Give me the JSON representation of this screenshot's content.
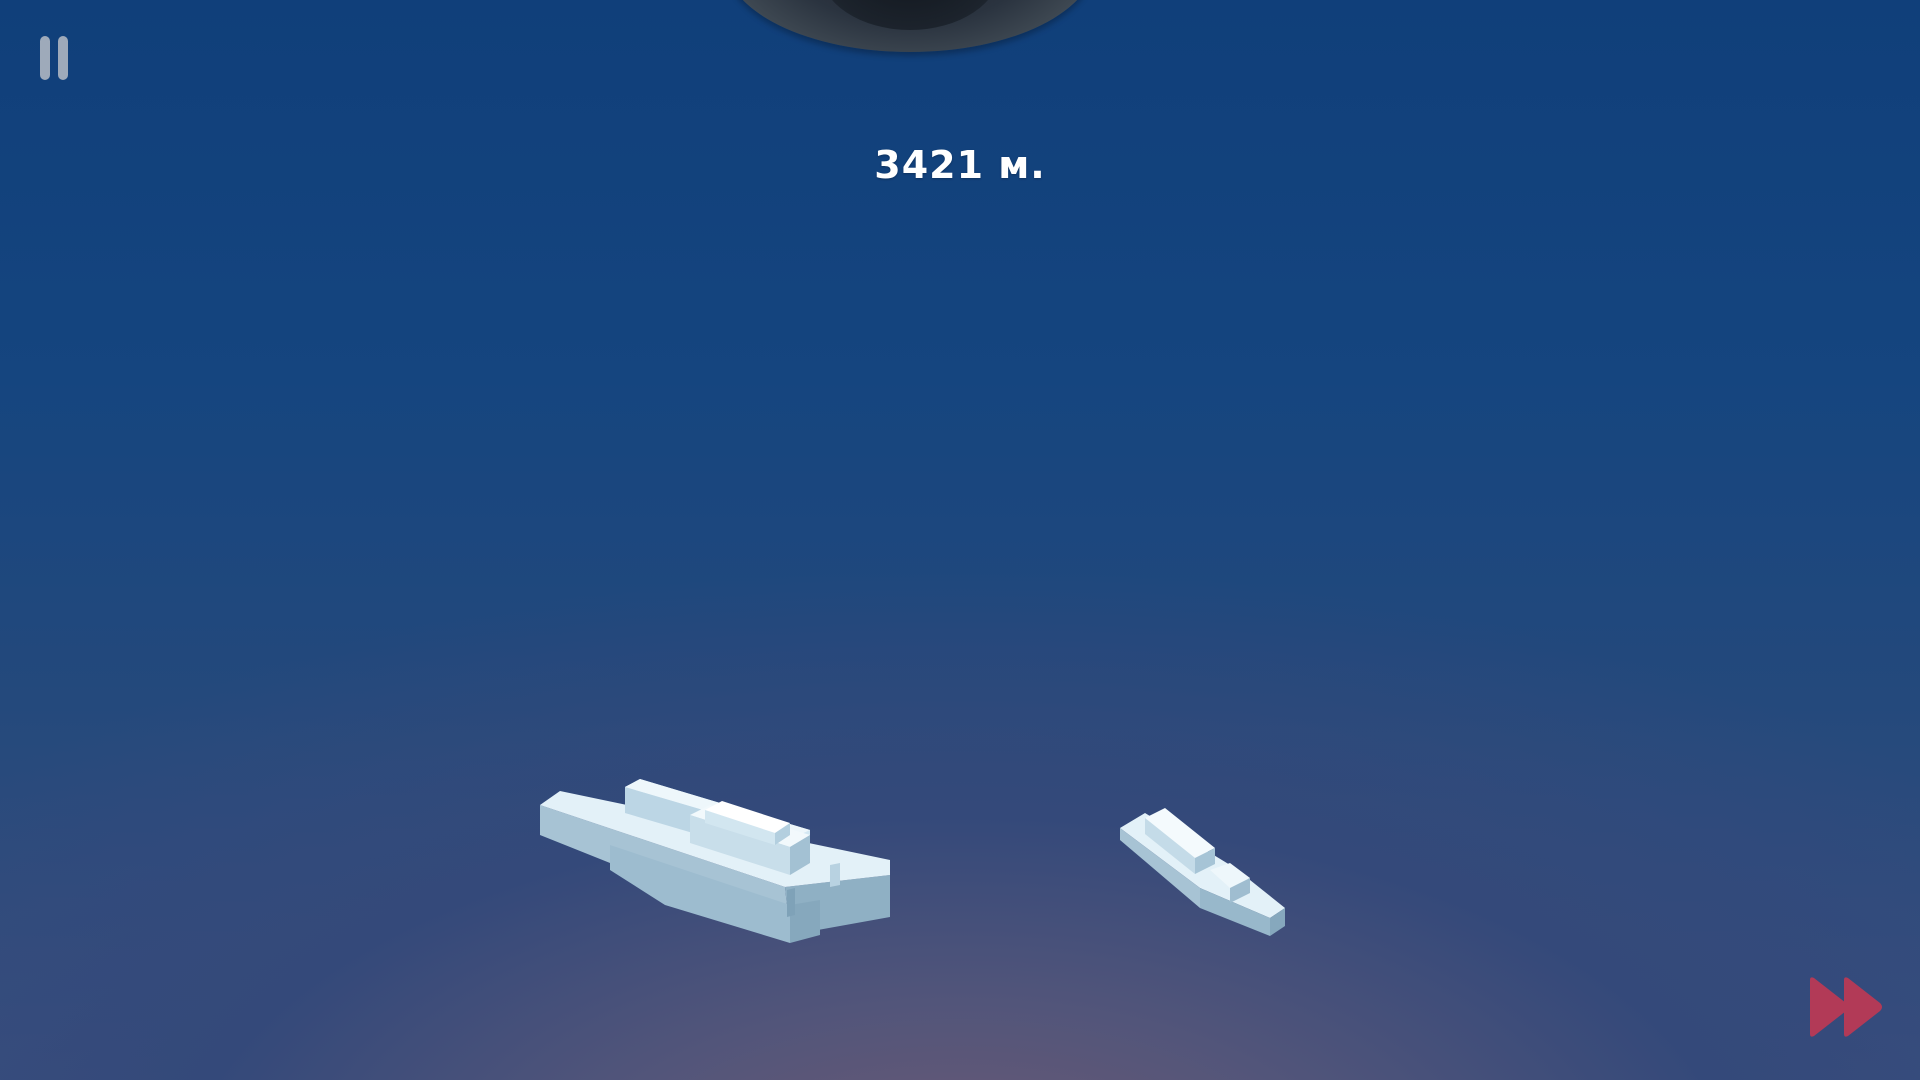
{
  "hud": {
    "depth_value": "3421 м.",
    "pause_icon": "pause-icon",
    "fast_forward_icon": "fast-forward-icon",
    "fast_forward_color": "#b23a57"
  },
  "scene": {
    "sky_top_color": "#103f7a",
    "sky_bottom_glow_color": "#6e5a74",
    "ships": [
      {
        "name": "large-voxel-ship",
        "color": "#d8ecf6"
      },
      {
        "name": "small-voxel-ship",
        "color": "#d8ecf6"
      }
    ],
    "porthole": "porthole-lens"
  }
}
